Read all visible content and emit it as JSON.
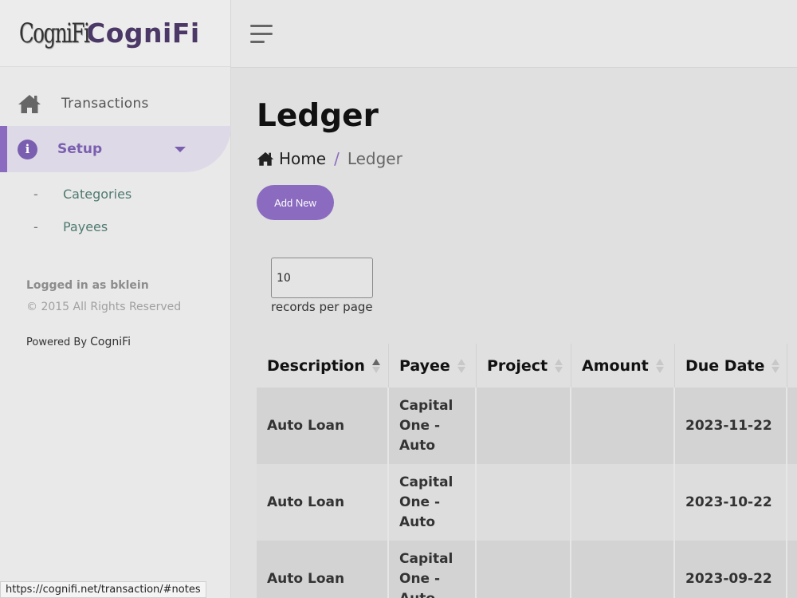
{
  "brand": {
    "logo_text": "CogniFi",
    "name": "CogniFi"
  },
  "sidebar": {
    "items": [
      {
        "label": "Transactions",
        "icon": "home-icon"
      },
      {
        "label": "Setup",
        "icon": "info-icon"
      }
    ],
    "sub_items": [
      {
        "dash": "-",
        "label": "Categories"
      },
      {
        "dash": "-",
        "label": "Payees"
      }
    ],
    "logged_in": "Logged in as bklein",
    "rights": "© 2015 All Rights Reserved",
    "powered_prefix": "Powered By",
    "powered_brand": "CogniFi"
  },
  "page": {
    "title": "Ledger",
    "breadcrumb": {
      "home": "Home",
      "sep": "/",
      "current": "Ledger"
    },
    "add_button": "Add New",
    "per_page_value": "10",
    "per_page_label": "records per page"
  },
  "table": {
    "columns": [
      "Description",
      "Payee",
      "Project",
      "Amount",
      "Due Date"
    ],
    "rows": [
      {
        "description": "Auto Loan",
        "payee": "Capital One - Auto",
        "project": "",
        "amount": "",
        "due_date": "2023-11-22"
      },
      {
        "description": "Auto Loan",
        "payee": "Capital One - Auto",
        "project": "",
        "amount": "",
        "due_date": "2023-10-22"
      },
      {
        "description": "Auto Loan",
        "payee": "Capital One - Auto",
        "project": "",
        "amount": "",
        "due_date": "2023-09-22"
      }
    ]
  },
  "status_bar": {
    "url": "https://cognifi.net/transaction/#notes"
  },
  "colors": {
    "accent": "#8a6bbf",
    "brand_text": "#4b3866",
    "sub_link": "#4f7a70"
  }
}
